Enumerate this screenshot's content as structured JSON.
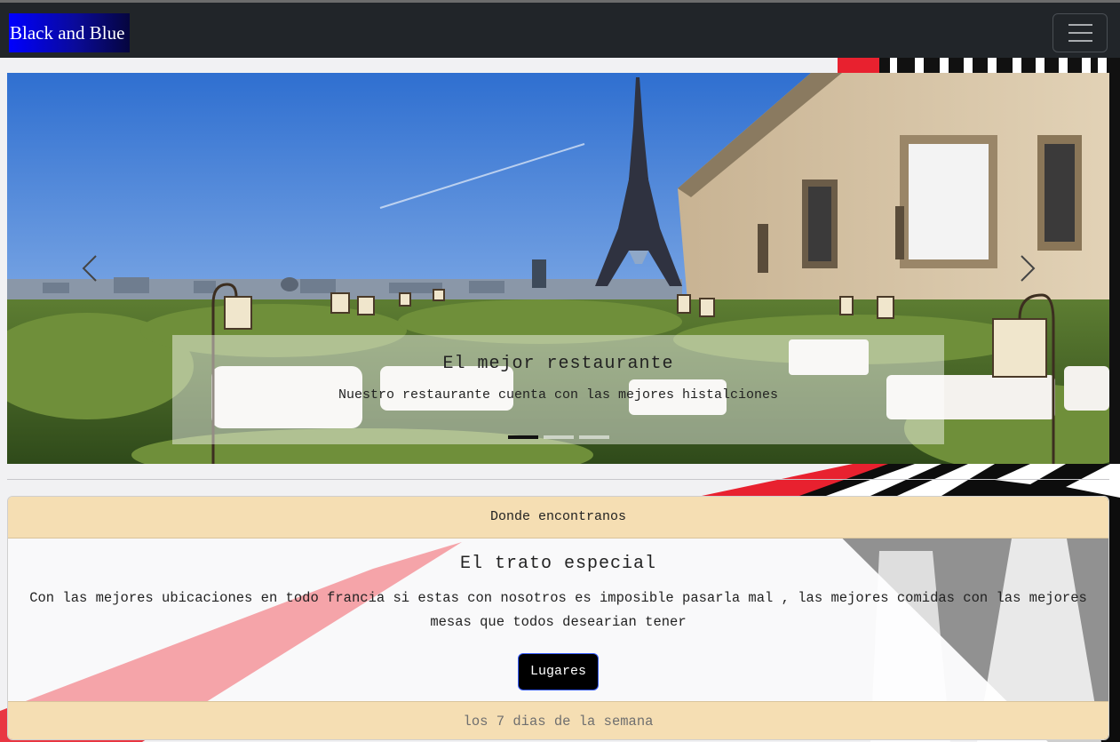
{
  "navbar": {
    "brand": "Black and Blue",
    "toggler_icon": "hamburger-icon"
  },
  "carousel": {
    "slide_title": "El mejor restaurante",
    "slide_text": "Nuestro restaurante cuenta con las mejores histalciones",
    "prev_icon": "chevron-left-icon",
    "next_icon": "chevron-right-icon",
    "slide_count": 3,
    "active_slide": 1
  },
  "card": {
    "header": "Donde encontranos",
    "title": "El trato especial",
    "text": "Con las mejores ubicaciones en todo francia si estas con nosotros es imposible pasarla mal , las mejores comidas con las mejores mesas que todos desearian tener",
    "button_label": "Lugares",
    "footer": "los 7 dias de la semana"
  },
  "colors": {
    "navbar_bg": "#212529",
    "brand_blue": "#0000ff",
    "card_header_bg": "#f5deb3",
    "button_bg": "#000000",
    "accent_red": "#e8212f"
  }
}
